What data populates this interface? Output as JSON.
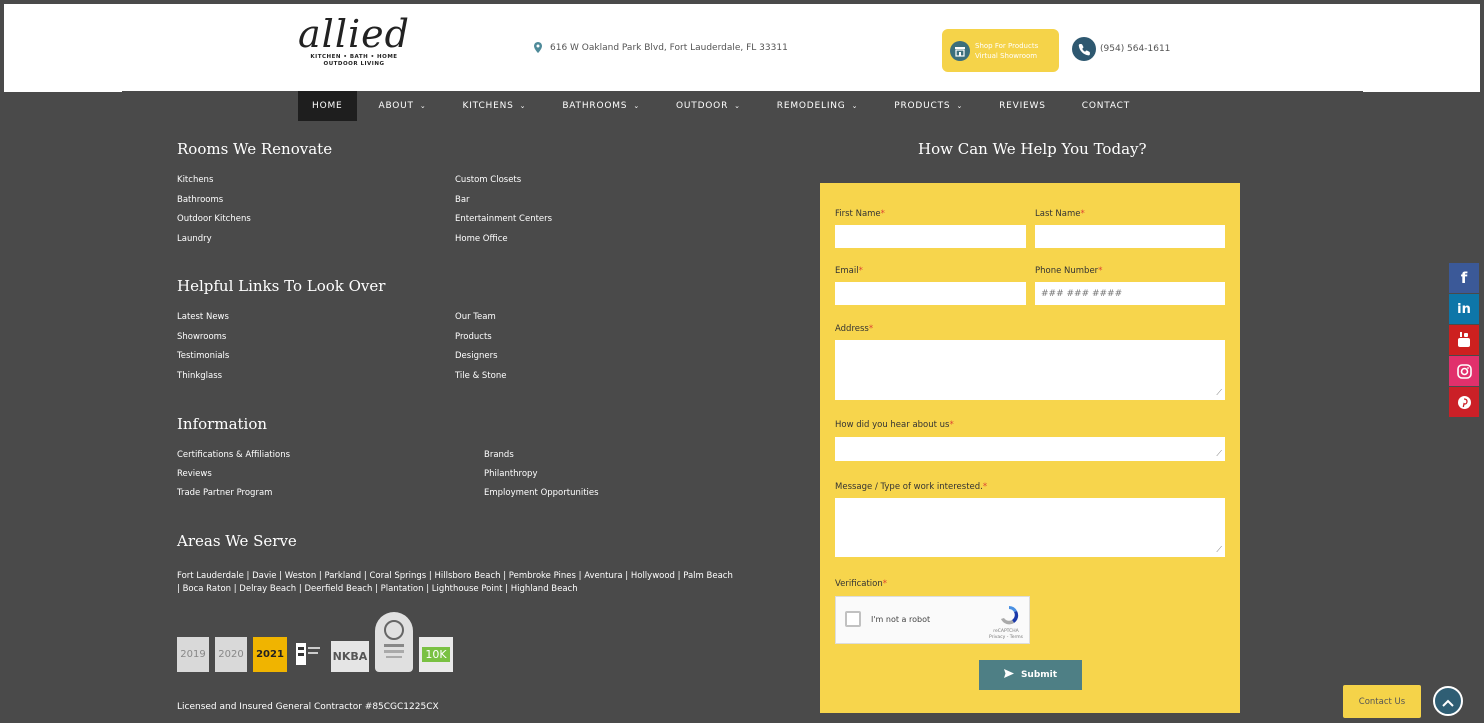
{
  "header": {
    "logo_script": "allied",
    "logo_tagline_1": "KITCHEN • BATH • HOME",
    "logo_tagline_2": "OUTDOOR LIVING",
    "address": "616 W Oakland Park Blvd, Fort Lauderdale, FL 33311",
    "shop_line1": "Shop For Products",
    "shop_line2": "Virtual Showroom",
    "phone": "(954) 564-1611"
  },
  "nav": {
    "items": [
      {
        "label": "HOME",
        "dropdown": false
      },
      {
        "label": "ABOUT",
        "dropdown": true
      },
      {
        "label": "KITCHENS",
        "dropdown": true
      },
      {
        "label": "BATHROOMS",
        "dropdown": true
      },
      {
        "label": "OUTDOOR",
        "dropdown": true
      },
      {
        "label": "REMODELING",
        "dropdown": true
      },
      {
        "label": "PRODUCTS",
        "dropdown": true
      },
      {
        "label": "REVIEWS",
        "dropdown": false
      },
      {
        "label": "CONTACT",
        "dropdown": false
      }
    ]
  },
  "rooms": {
    "title": "Rooms We Renovate",
    "col1": [
      "Kitchens",
      "Bathrooms",
      "Outdoor Kitchens",
      "Laundry"
    ],
    "col2": [
      "Custom Closets",
      "Bar",
      "Entertainment Centers",
      "Home Office"
    ]
  },
  "helpful": {
    "title": "Helpful Links To Look Over",
    "col1": [
      "Latest News",
      "Showrooms",
      "Testimonials",
      "Thinkglass"
    ],
    "col2": [
      "Our Team",
      "Products",
      "Designers",
      "Tile & Stone"
    ]
  },
  "information": {
    "title": "Information",
    "col1": [
      "Certifications & Affiliations",
      "Reviews",
      "Trade Partner Program"
    ],
    "col2": [
      "Brands",
      "Philanthropy",
      "Employment Opportunities"
    ]
  },
  "areas": {
    "title": "Areas We Serve",
    "text": "Fort Lauderdale | Davie | Weston | Parkland | Coral Springs | Hillsboro Beach | Pembroke Pines | Aventura | Hollywood | Palm Beach | Boca Raton | Delray Beach | Deerfield Beach | Plantation | Lighthouse Point | Highland Beach"
  },
  "badges": {
    "houzz_2019": "2019",
    "houzz_2020": "2020",
    "year_2021": "2021",
    "nkba": "NKBA",
    "houzz_10k": "10K"
  },
  "license": "Licensed and Insured General Contractor #85CGC1225CX",
  "form": {
    "title": "How Can We Help You Today?",
    "first_name_label": "First Name",
    "last_name_label": "Last Name",
    "email_label": "Email",
    "phone_label": "Phone Number",
    "phone_placeholder": "### ### ####",
    "address_label": "Address",
    "hear_label": "How did you hear about us",
    "message_label": "Message / Type of work interested.",
    "verification_label": "Verification",
    "captcha_text": "I'm not a robot",
    "captcha_brand": "reCAPTCHA",
    "captcha_terms": "Privacy - Terms",
    "submit_label": "Submit",
    "required_mark": "*"
  },
  "social": [
    "f",
    "in"
  ],
  "contact_us": "Contact Us",
  "colors": {
    "background": "#4a4a4a",
    "form_yellow": "#f7d54c",
    "submit_teal": "#4e7f85",
    "facebook": "#3b5998",
    "linkedin": "#0e76a8",
    "youtube": "#cd201f",
    "instagram": "#e1306c",
    "pinterest": "#cb2027"
  }
}
